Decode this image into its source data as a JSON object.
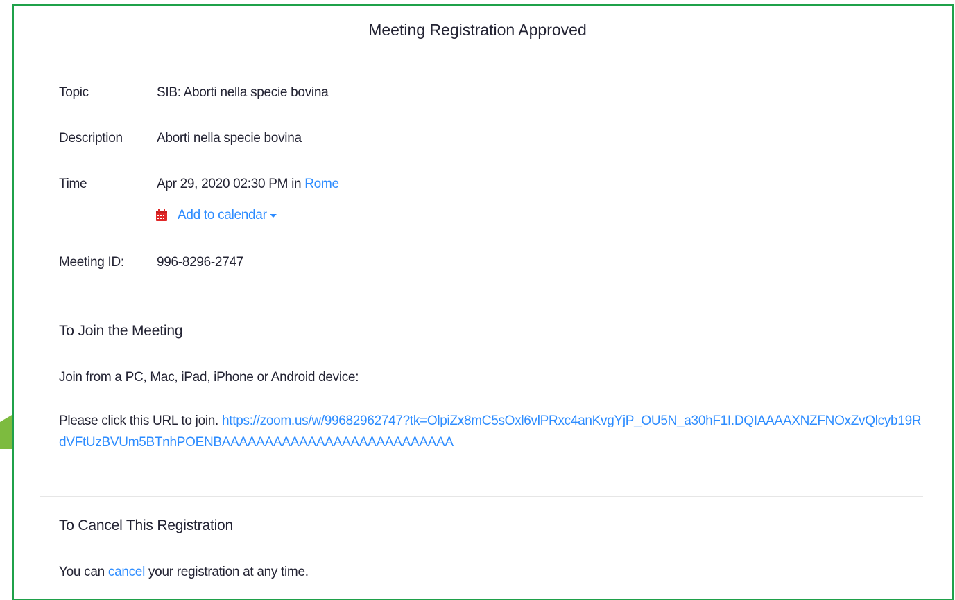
{
  "title": "Meeting Registration Approved",
  "fields": {
    "topic_label": "Topic",
    "topic_value": "SIB: Aborti nella specie bovina",
    "description_label": "Description",
    "description_value": "Aborti nella specie bovina",
    "time_label": "Time",
    "time_value": "Apr 29, 2020 02:30 PM in",
    "time_zone_link": "Rome",
    "add_to_calendar": "Add to calendar",
    "meeting_id_label": "Meeting ID:",
    "meeting_id_value": "996-8296-2747"
  },
  "join": {
    "heading": "To Join the Meeting",
    "devices_text": "Join from a PC, Mac, iPad, iPhone or Android device:",
    "url_prefix": "Please click this URL to join.",
    "url": "https://zoom.us/w/99682962747?tk=OlpiZx8mC5sOxl6vlPRxc4anKvgYjP_OU5N_a30hF1I.DQIAAAAXNZFNOxZvQlcyb19RdVFtUzBVUm5BTnhPOENBAAAAAAAAAAAAAAAAAAAAAAAAAAA"
  },
  "cancel": {
    "heading": "To Cancel This Registration",
    "text_before": "You can",
    "link": "cancel",
    "text_after": "your registration at any time."
  },
  "colors": {
    "accent_link": "#2d8cff",
    "frame_border": "#1fa14a",
    "arrow": "#7dbb3f",
    "calendar_icon": "#e02828"
  },
  "icons": {
    "calendar": "calendar-icon",
    "dropdown": "caret-down-icon"
  }
}
